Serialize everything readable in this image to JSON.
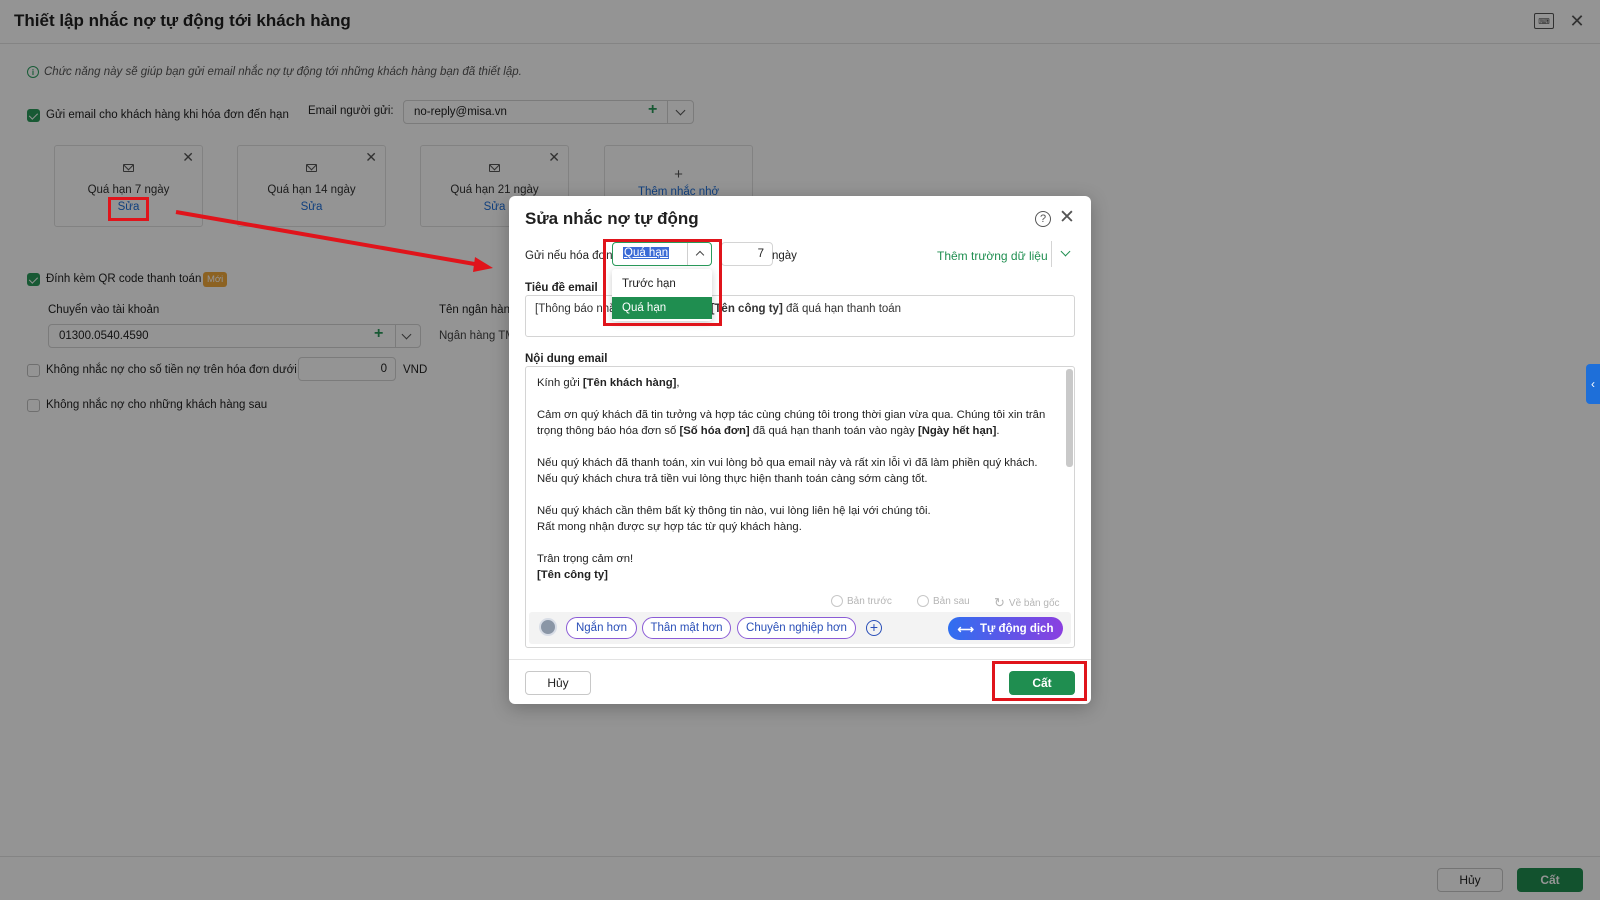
{
  "page": {
    "title": "Thiết lập nhắc nợ tự động tới khách hàng",
    "info": "Chức năng này sẽ giúp bạn gửi email nhắc nợ tự động tới những khách hàng bạn đã thiết lập."
  },
  "settings": {
    "send_email_label": "Gửi email cho khách hàng khi hóa đơn đến hạn",
    "sender_label": "Email người gửi:",
    "sender_value": "no-reply@misa.vn",
    "reminders": [
      {
        "title": "Quá hạn 7 ngày",
        "edit": "Sửa"
      },
      {
        "title": "Quá hạn 14 ngày",
        "edit": "Sửa"
      },
      {
        "title": "Quá hạn 21 ngày",
        "edit": "Sửa"
      }
    ],
    "add_reminder_label": "Thêm nhắc nhở",
    "qr_label": "Đính kèm QR code thanh toán",
    "new_badge": "Mới",
    "account_label": "Chuyển vào tài khoản",
    "account_value": "01300.0540.4590",
    "bank_label": "Tên ngân hàng",
    "bank_value": "Ngân hàng TMCP",
    "min_amount_label": "Không nhắc nợ cho số tiền nợ trên hóa đơn dưới",
    "min_amount_value": "0",
    "currency": "VND",
    "exclude_label": "Không nhắc nợ cho những khách hàng sau"
  },
  "footer": {
    "cancel": "Hủy",
    "save": "Cất"
  },
  "modal": {
    "title": "Sửa nhắc nợ tự động",
    "condition_label": "Gửi nếu hóa đơn",
    "condition_value": "Quá hạn",
    "days_value": "7",
    "days_unit": "ngày",
    "add_field": "Thêm trường dữ liệu",
    "dropdown_options": [
      "Trước hạn",
      "Quá hạn"
    ],
    "subject_label": "Tiêu đề email",
    "subject_prefix": "[Thông báo nhắ",
    "subject_company": "[Tên công ty]",
    "subject_suffix": " đã quá hạn thanh toán",
    "body_label": "Nội dung email",
    "body": {
      "greet": "Kính gửi ",
      "greet_tag": "[Tên khách hàng]",
      "greet_end": ",",
      "p2a": "Cảm ơn quý khách đã tin tưởng và hợp tác cùng chúng tôi trong thời gian vừa qua. Chúng tôi xin trân trọng thông báo hóa đơn số ",
      "p2_tag1": "[Số hóa đơn]",
      "p2b": " đã quá hạn thanh toán vào ngày ",
      "p2_tag2": "[Ngày hết hạn]",
      "p2c": ".",
      "p3": "Nếu quý khách đã thanh toán, xin vui lòng bỏ qua email này và rất xin lỗi vì đã làm phiền quý khách. Nếu quý khách chưa trả tiền vui lòng thực hiện thanh toán càng sớm càng tốt.",
      "p4a": "Nếu quý khách cần thêm bất kỳ thông tin nào, vui lòng liên hệ lại với chúng tôi.",
      "p4b": "Rất mong nhận được sự hợp tác từ quý khách hàng.",
      "p5a": "Trân trọng cảm ơn!",
      "p5b": "[Tên công ty]"
    },
    "history": {
      "prev": "Bản trước",
      "next": "Bản sau",
      "original": "Về bản gốc"
    },
    "ai_options": [
      "Ngắn hơn",
      "Thân mật hơn",
      "Chuyên nghiệp hơn"
    ],
    "ai_translate": "Tự động dịch",
    "cancel": "Hủy",
    "save": "Cất"
  }
}
